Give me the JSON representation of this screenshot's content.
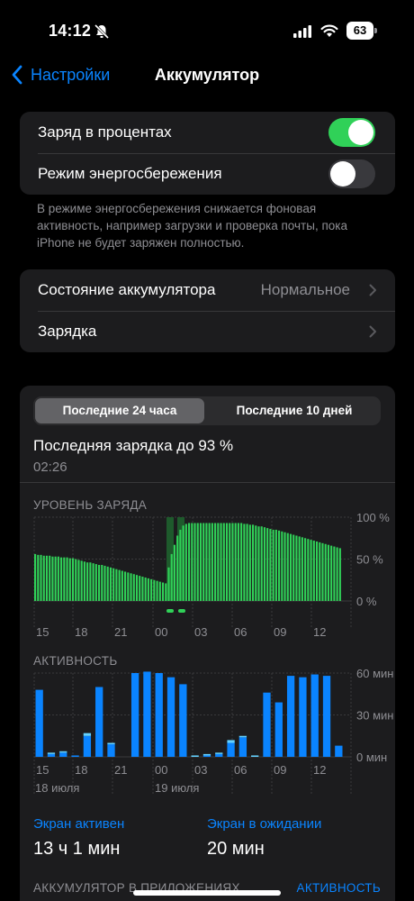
{
  "status_bar": {
    "time": "14:12",
    "battery": "63"
  },
  "nav": {
    "back_label": "Настройки",
    "title": "Аккумулятор"
  },
  "settings": {
    "battery_percentage": {
      "label": "Заряд в процентах",
      "enabled": true
    },
    "low_power_mode": {
      "label": "Режим энергосбережения",
      "enabled": false
    },
    "footnote": "В режиме энергосбережения снижается фоновая активность, например загрузки и проверка почты, пока iPhone не будет заряжен полностью."
  },
  "health": {
    "state_label": "Состояние аккумулятора",
    "state_value": "Нормальное",
    "charging_label": "Зарядка"
  },
  "usage": {
    "tabs": [
      {
        "label": "Последние 24 часа",
        "selected": true
      },
      {
        "label": "Последние 10 дней",
        "selected": false
      }
    ],
    "last_charge": "Последняя зарядка до 93 %",
    "last_charge_time": "02:26",
    "battery_chart_title": "УРОВЕНЬ ЗАРЯДА",
    "activity_chart_title": "АКТИВНОСТЬ",
    "screen_on": {
      "label": "Экран активен",
      "value": "13 ч 1 мин"
    },
    "screen_off": {
      "label": "Экран в ожидании",
      "value": "20 мин"
    },
    "apps_header": "АККУМУЛЯТОР В ПРИЛОЖЕНИЯХ",
    "apps_toggle": "АКТИВНОСТЬ"
  },
  "colors": {
    "accent": "#0a84ff",
    "toggle_on": "#30d158",
    "battery_bar": "#30d158",
    "activity_screen_on": "#0a84ff",
    "activity_screen_off": "#64d2ff",
    "group_bg": "#1c1c1e"
  },
  "chart_data": [
    {
      "type": "bar",
      "title": "УРОВЕНЬ ЗАРЯДА",
      "x_tick_labels": [
        "15",
        "18",
        "21",
        "00",
        "03",
        "06",
        "09",
        "12"
      ],
      "y_tick_labels": [
        "100 %",
        "50 %",
        "0 %"
      ],
      "ylim": [
        0,
        100
      ],
      "values": [
        56,
        55,
        55,
        54,
        54,
        54,
        53,
        53,
        53,
        52,
        52,
        52,
        51,
        51,
        50,
        49,
        48,
        47,
        46,
        46,
        45,
        44,
        43,
        43,
        42,
        41,
        40,
        39,
        38,
        37,
        36,
        35,
        34,
        33,
        32,
        31,
        30,
        29,
        28,
        27,
        26,
        25,
        24,
        23,
        22,
        21,
        40,
        56,
        67,
        78,
        85,
        90,
        92,
        93,
        93,
        93,
        93,
        93,
        93,
        93,
        93,
        93,
        93,
        93,
        93,
        93,
        93,
        93,
        93,
        93,
        93,
        93,
        92,
        92,
        91,
        91,
        90,
        89,
        89,
        88,
        87,
        86,
        85,
        85,
        84,
        83,
        82,
        81,
        80,
        79,
        78,
        77,
        76,
        75,
        74,
        73,
        72,
        71,
        70,
        69,
        68,
        67,
        66,
        65,
        64,
        63
      ],
      "charging_markers_x": [
        "00",
        "00"
      ]
    },
    {
      "type": "bar",
      "title": "АКТИВНОСТЬ",
      "x_tick_labels": [
        "15",
        "18",
        "21",
        "00",
        "03",
        "06",
        "09",
        "12"
      ],
      "x_date_labels": [
        "18 июля",
        "19 июля"
      ],
      "y_tick_labels": [
        "60 мин",
        "30 мин",
        "0 мин"
      ],
      "ylim": [
        0,
        60
      ],
      "series": [
        {
          "name": "Экран активен",
          "values": [
            48,
            2,
            3,
            1,
            15,
            50,
            9,
            0,
            60,
            61,
            60,
            57,
            52,
            0,
            1,
            2,
            10,
            14,
            0,
            46,
            39,
            58,
            57,
            59,
            58,
            8
          ]
        },
        {
          "name": "Экран в ожидании",
          "values": [
            0,
            1,
            1,
            0,
            2,
            0,
            1,
            0,
            0,
            0,
            0,
            0,
            0,
            1,
            1,
            1,
            2,
            1,
            1,
            0,
            0,
            0,
            0,
            0,
            0,
            0
          ]
        }
      ]
    }
  ]
}
